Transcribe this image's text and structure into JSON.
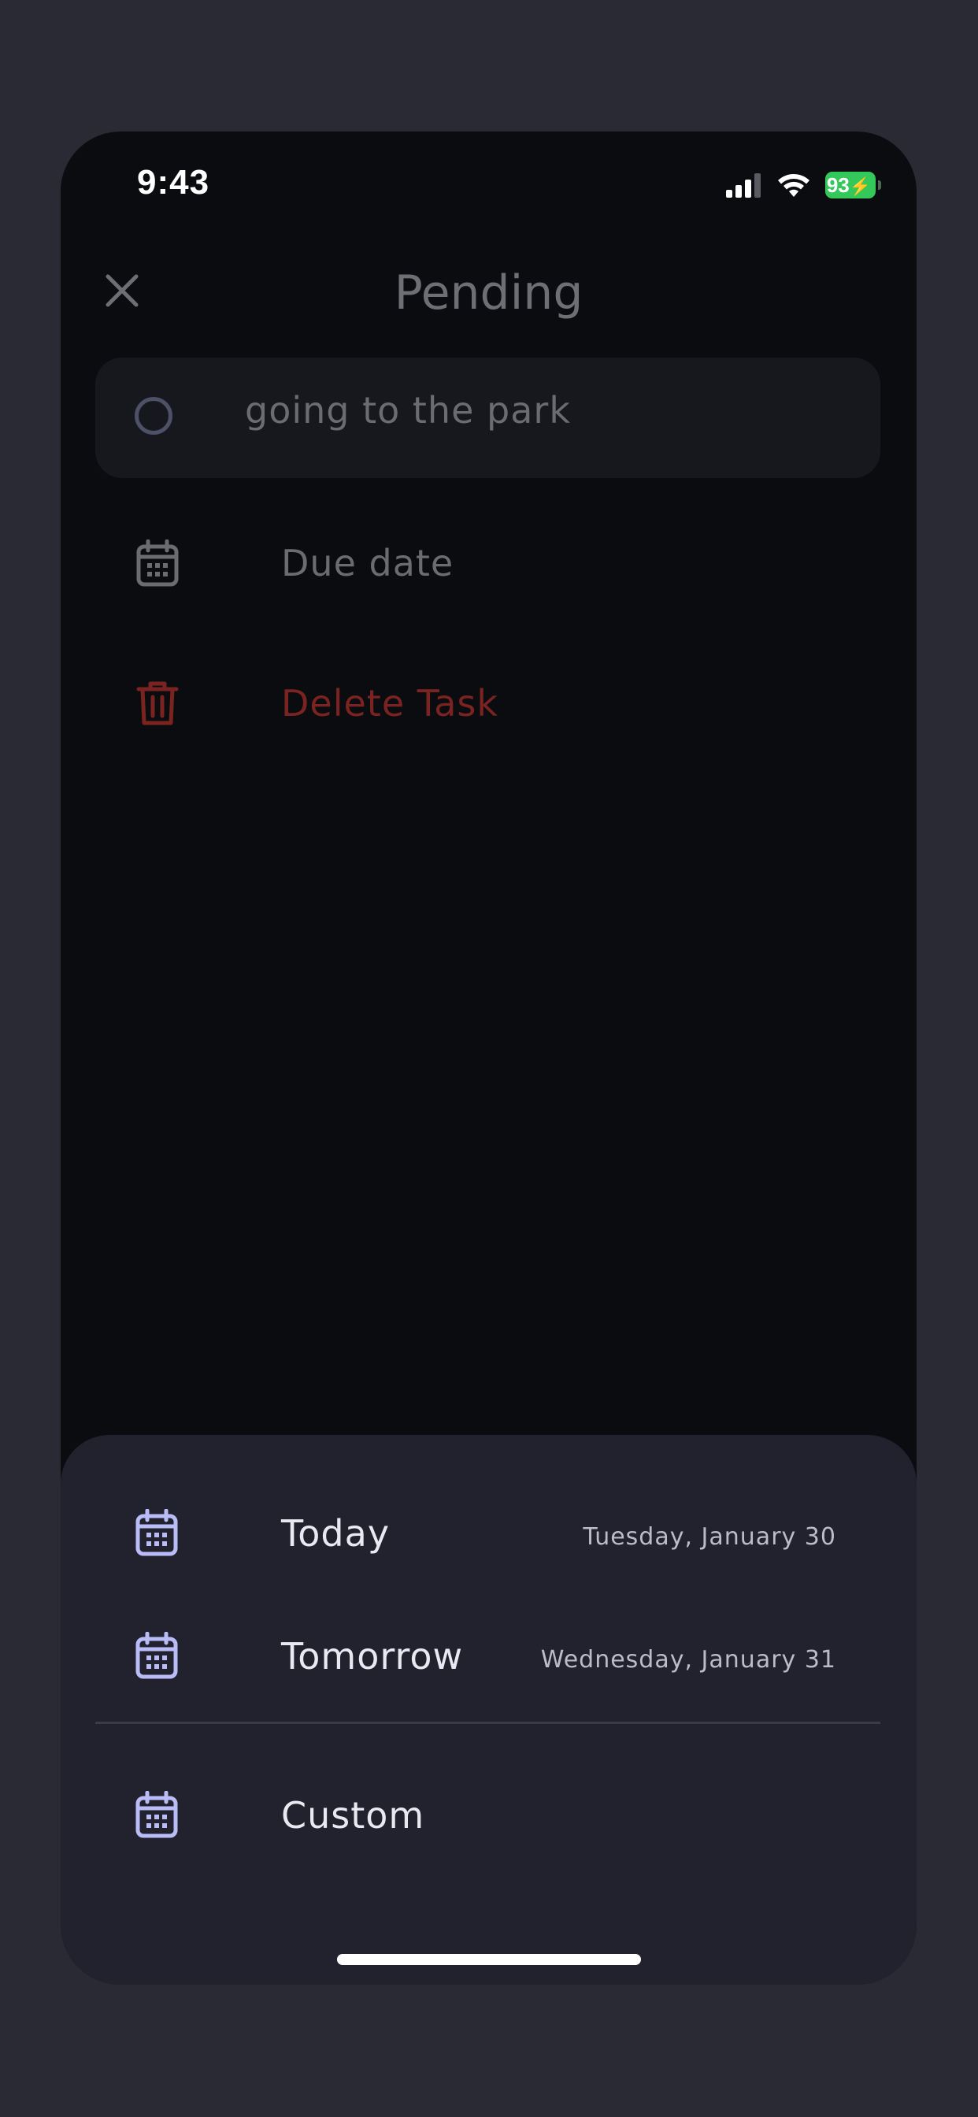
{
  "status_bar": {
    "time": "9:43",
    "battery_level": "93",
    "icons": [
      "cellular-signal-icon",
      "wifi-icon",
      "battery-charging-icon"
    ]
  },
  "header": {
    "title": "Pending",
    "close_icon": "close-icon"
  },
  "task": {
    "title": "going to the park",
    "completed": false
  },
  "actions": {
    "due_date_label": "Due date",
    "delete_label": "Delete Task"
  },
  "due_date_sheet": {
    "options": [
      {
        "label": "Today",
        "date": "Tuesday, January 30",
        "icon": "calendar-icon"
      },
      {
        "label": "Tomorrow",
        "date": "Wednesday, January 31",
        "icon": "calendar-icon"
      },
      {
        "label": "Custom",
        "date": "",
        "icon": "calendar-icon"
      }
    ]
  },
  "colors": {
    "page_background": "#2a2a35",
    "screen_background": "#0b0c10",
    "sheet_background": "#21222d",
    "accent_calendar": "#b9bcf7",
    "danger": "#7a2321",
    "battery": "#34c759"
  }
}
